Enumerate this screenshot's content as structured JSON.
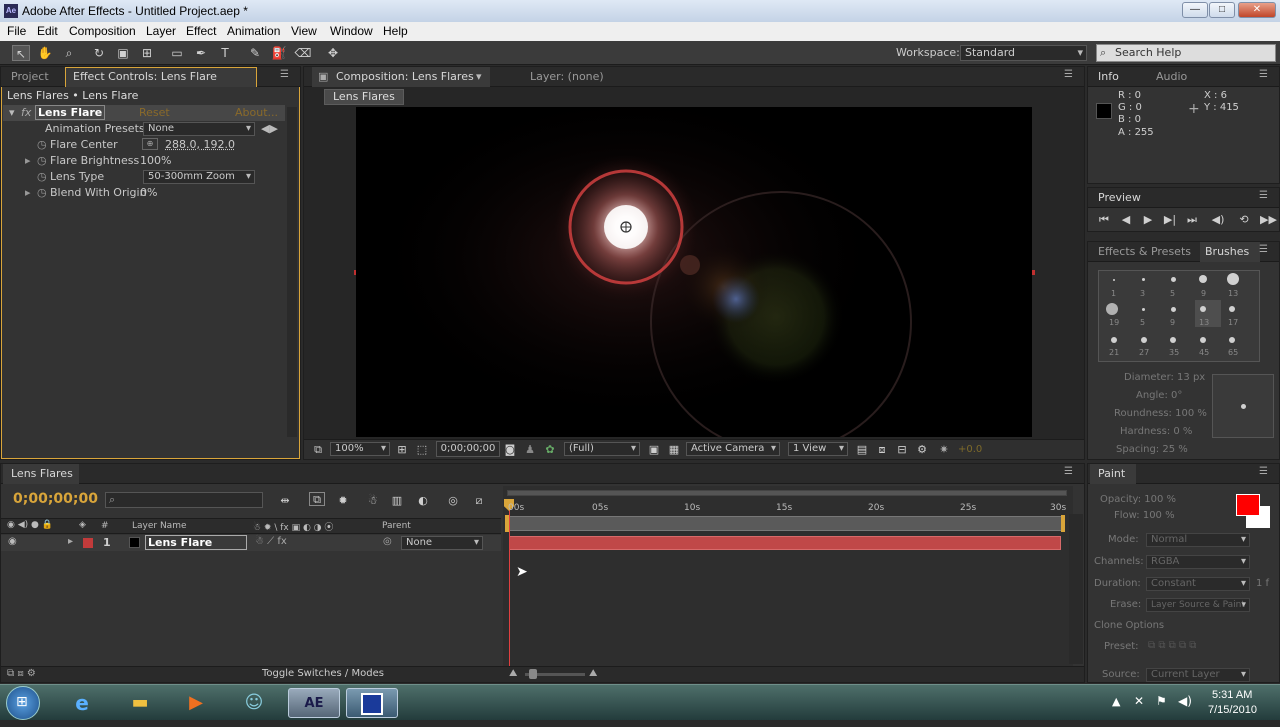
{
  "window": {
    "title": "Adobe After Effects - Untitled Project.aep *",
    "app_icon": "Ae",
    "controls": {
      "minimize": "—",
      "maximize": "□",
      "close": "✕"
    }
  },
  "menu": [
    "File",
    "Edit",
    "Composition",
    "Layer",
    "Effect",
    "Animation",
    "View",
    "Window",
    "Help"
  ],
  "toolbar": {
    "workspace_label": "Workspace:",
    "workspace_value": "Standard",
    "search_placeholder": "Search Help"
  },
  "left_panel": {
    "tabs": {
      "project": "Project",
      "effect_controls": "Effect Controls: Lens Flare"
    },
    "breadcrumb": "Lens Flares • Lens Flare",
    "effect": {
      "name": "Lens Flare",
      "reset": "Reset",
      "about": "About..."
    },
    "animation_presets": {
      "label": "Animation Presets:",
      "value": "None"
    },
    "props": [
      {
        "label": "Flare Center",
        "value": "288.0, 192.0"
      },
      {
        "label": "Flare Brightness",
        "value": "100%"
      },
      {
        "label": "Lens Type",
        "value": "50-300mm Zoom"
      },
      {
        "label": "Blend With Origin",
        "value": "0%"
      }
    ]
  },
  "comp_panel": {
    "tab": "Composition: Lens Flares",
    "layer_tab": "Layer: (none)",
    "subtab": "Lens Flares",
    "zoom": "100%",
    "timecode": "0;00;00;00",
    "resolution": "(Full)",
    "camera": "Active Camera",
    "views": "1 View",
    "exposure": "+0.0"
  },
  "info": {
    "tab": "Info",
    "audio_tab": "Audio",
    "r": "R : 0",
    "g": "G : 0",
    "b": "B : 0",
    "a": "A : 255",
    "x": "X : 6",
    "y": "Y : 415"
  },
  "preview": {
    "tab": "Preview"
  },
  "effects_presets": {
    "tab": "Effects & Presets",
    "brushes_tab": "Brushes",
    "brush_sizes": [
      "1",
      "3",
      "5",
      "9",
      "13",
      "19",
      "5",
      "9",
      "13",
      "17",
      "21",
      "27",
      "35",
      "45",
      "65"
    ],
    "diameter": "Diameter: 13 px",
    "angle": "Angle: 0°",
    "roundness": "Roundness: 100 %",
    "hardness": "Hardness: 0 %",
    "spacing": "Spacing: 25 %"
  },
  "paint": {
    "tab": "Paint",
    "opacity": "Opacity: 100 %",
    "flow": "Flow: 100 %",
    "mode_label": "Mode:",
    "mode": "Normal",
    "channels_label": "Channels:",
    "channels": "RGBA",
    "duration_label": "Duration:",
    "duration": "Constant",
    "duration_value": "1 f",
    "erase_label": "Erase:",
    "erase": "Layer Source & Paint",
    "clone_options": "Clone Options",
    "preset_label": "Preset:",
    "source_label": "Source:",
    "source": "Current Layer",
    "foreground_color": "#ff0000",
    "background_color": "#ffffff"
  },
  "timeline": {
    "tab": "Lens Flares",
    "timecode": "0;00;00;00",
    "col_hash": "#",
    "col_layer_name": "Layer Name",
    "col_parent": "Parent",
    "ruler": [
      "00s",
      "05s",
      "10s",
      "15s",
      "20s",
      "25s",
      "30s"
    ],
    "layer": {
      "index": "1",
      "name": "Lens Flare",
      "parent": "None",
      "color": "#c23b3b"
    },
    "toggle_label": "Toggle Switches / Modes"
  },
  "taskbar": {
    "time": "5:31 AM",
    "date": "7/15/2010",
    "ae_label": "AE"
  }
}
